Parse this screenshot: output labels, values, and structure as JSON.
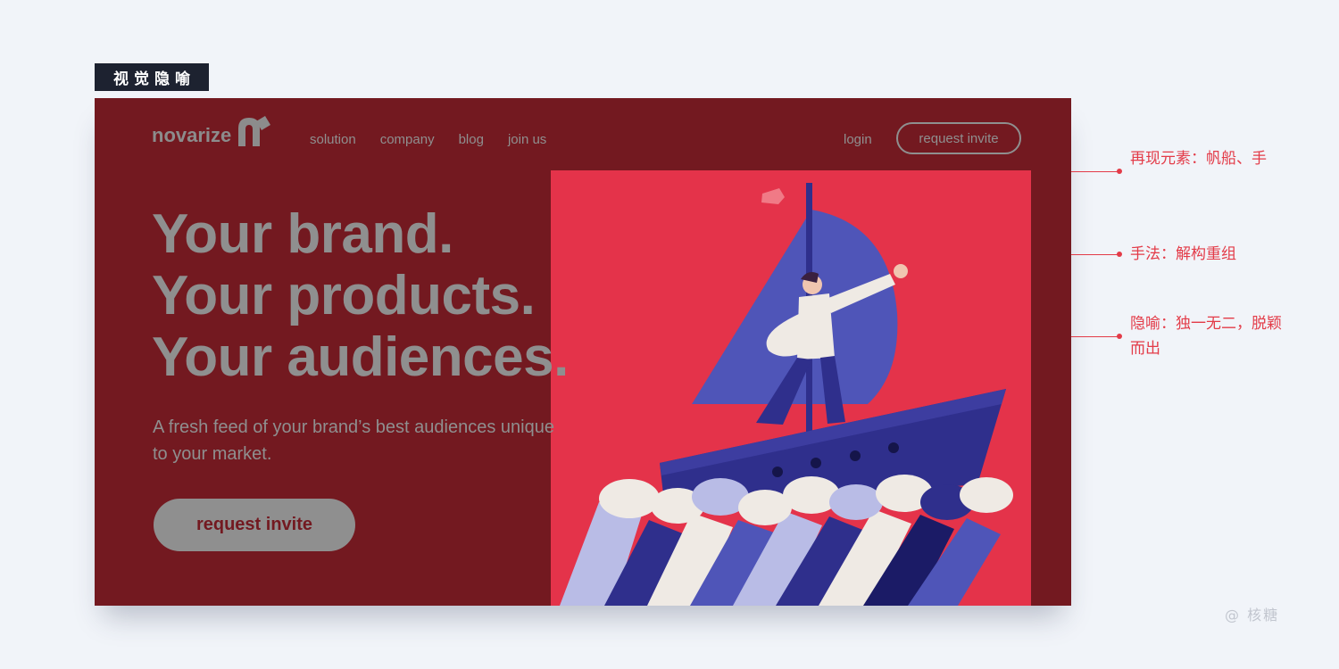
{
  "tag": "视觉隐喻",
  "site": {
    "logo_text": "novarize",
    "nav": [
      "solution",
      "company",
      "blog",
      "join us"
    ],
    "login": "login",
    "nav_cta": "request invite",
    "headline": [
      "Your brand.",
      "Your products.",
      "Your audiences."
    ],
    "subtext": "A fresh feed of your brand’s best audiences unique to your market.",
    "hero_cta": "request invite",
    "colors": {
      "background": "#731920",
      "illustration_bg": "#e4334a",
      "text_gray": "#8f8f8f",
      "navy": "#2f2f8c",
      "sail": "#4f55b8"
    }
  },
  "annotations": [
    "再现元素：帆船、手",
    "手法：解构重组",
    "隐喻：独一无二，脱颖而出"
  ],
  "credit": "@ 核糖",
  "icons": {
    "logo_mark": "brand-n-icon",
    "illustration": "ship-on-hands-illustration"
  }
}
